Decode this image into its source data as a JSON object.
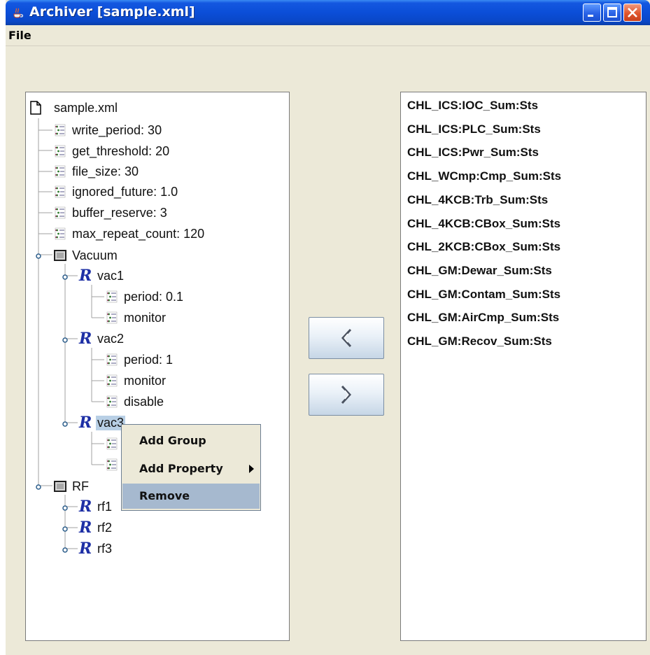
{
  "window": {
    "title": "Archiver [sample.xml]",
    "controls": [
      "minimize-icon",
      "maximize-icon",
      "close-icon"
    ]
  },
  "menubar": {
    "file": "File"
  },
  "tree": {
    "root": "sample.xml",
    "properties": [
      "write_period: 30",
      "get_threshold: 20",
      "file_size: 30",
      "ignored_future: 1.0",
      "buffer_reserve: 3",
      "max_repeat_count: 120"
    ],
    "groups": [
      {
        "name": "Vacuum",
        "channels": [
          {
            "name": "vac1",
            "props": [
              "period: 0.1",
              "monitor"
            ]
          },
          {
            "name": "vac2",
            "props": [
              "period: 1",
              "monitor",
              "disable"
            ]
          },
          {
            "name": "vac3",
            "selected": true
          }
        ]
      },
      {
        "name": "RF",
        "channels": [
          {
            "name": "rf1"
          },
          {
            "name": "rf2"
          },
          {
            "name": "rf3"
          }
        ]
      }
    ]
  },
  "buttons": {
    "move_left": "«",
    "move_right": "»"
  },
  "context_menu": {
    "items": [
      "Add Group",
      "Add Property",
      "Remove"
    ],
    "highlighted": "Remove"
  },
  "channel_list": [
    "CHL_ICS:IOC_Sum:Sts",
    "CHL_ICS:PLC_Sum:Sts",
    "CHL_ICS:Pwr_Sum:Sts",
    "CHL_WCmp:Cmp_Sum:Sts",
    "CHL_4KCB:Trb_Sum:Sts",
    "CHL_4KCB:CBox_Sum:Sts",
    "CHL_2KCB:CBox_Sum:Sts",
    "CHL_GM:Dewar_Sum:Sts",
    "CHL_GM:Contam_Sum:Sts",
    "CHL_GM:AirCmp_Sum:Sts",
    "CHL_GM:Recov_Sum:Sts"
  ],
  "colors": {
    "titlebar": "#0b4ed8",
    "window_bg": "#ECE9D8",
    "selection": "#b8cfe5",
    "menu_highlight": "#a6b9cf",
    "channel_icon": "#1d2fa5"
  }
}
